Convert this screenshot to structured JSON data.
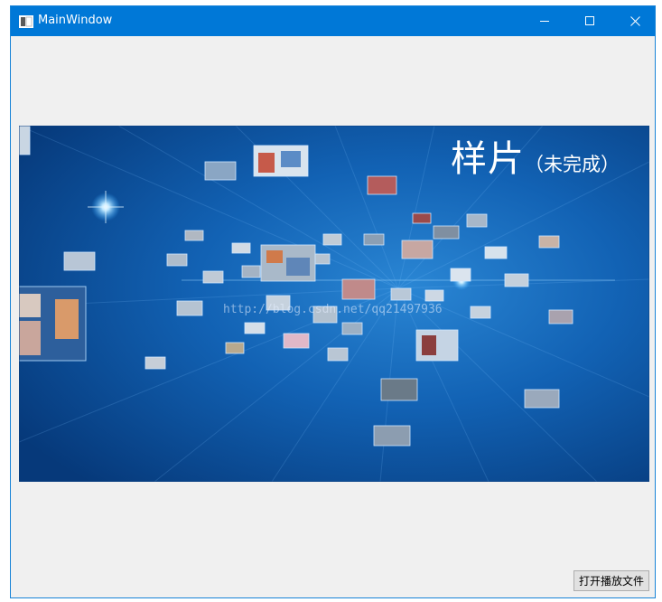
{
  "window": {
    "title": "MainWindow",
    "icon": "app-window-icon",
    "controls": {
      "minimize": "minimize-icon",
      "maximize": "maximize-icon",
      "close": "close-icon"
    }
  },
  "video": {
    "heading_main": "样片",
    "heading_sub": "（未完成）",
    "watermark": "http://blog.csdn.net/qq21497936",
    "background_color": "#0a4b94"
  },
  "actions": {
    "open_file_label": "打开播放文件"
  },
  "colors": {
    "titlebar": "#0078d7",
    "window_bg": "#f0f0f0",
    "button_bg": "#e1e1e1"
  }
}
